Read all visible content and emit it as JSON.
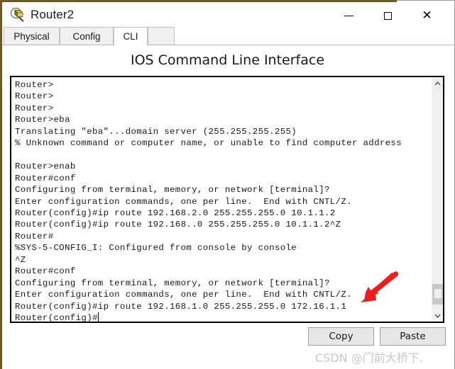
{
  "window": {
    "title": "Router2",
    "icon": "router-magnifier-icon",
    "frame_accent_color": "#6b5c23",
    "controls": [
      {
        "name": "minimize-button",
        "glyph": "minimize-icon",
        "label": "—"
      },
      {
        "name": "maximize-button",
        "glyph": "maximize-icon",
        "label": "☐"
      },
      {
        "name": "close-button",
        "glyph": "close-icon",
        "label": "✕"
      }
    ]
  },
  "tabs": {
    "items": [
      {
        "label": "Physical",
        "active": false
      },
      {
        "label": "Config",
        "active": false
      },
      {
        "label": "CLI",
        "active": true
      }
    ],
    "selected": "CLI"
  },
  "main": {
    "heading": "IOS Command Line Interface",
    "terminal": {
      "text": "Router>\nRouter>\nRouter>\nRouter>eba\nTranslating \"eba\"...domain server (255.255.255.255)\n% Unknown command or computer name, or unable to find computer address\n\nRouter>enab\nRouter#conf\nConfiguring from terminal, memory, or network [terminal]?\nEnter configuration commands, one per line.  End with CNTL/Z.\nRouter(config)#ip route 192.168.2.0 255.255.255.0 10.1.1.2\nRouter(config)#ip route 192.168..0 255.255.255.0 10.1.1.2^Z\nRouter#\n%SYS-5-CONFIG_I: Configured from console by console\n^Z\nRouter#conf\nConfiguring from terminal, memory, or network [terminal]?\nEnter configuration commands, one per line.  End with CNTL/Z.\nRouter(config)#ip route 192.168.1.0 255.255.255.0 172.16.1.1\nRouter(config)#",
      "lines": [
        "Router>",
        "Router>",
        "Router>",
        "Router>eba",
        "Translating \"eba\"...domain server (255.255.255.255)",
        "% Unknown command or computer name, or unable to find computer address",
        "",
        "Router>enab",
        "Router#conf",
        "Configuring from terminal, memory, or network [terminal]?",
        "Enter configuration commands, one per line.  End with CNTL/Z.",
        "Router(config)#ip route 192.168.2.0 255.255.255.0 10.1.1.2",
        "Router(config)#ip route 192.168..0 255.255.255.0 10.1.1.2^Z",
        "Router#",
        "%SYS-5-CONFIG_I: Configured from console by console",
        "^Z",
        "Router#conf",
        "Configuring from terminal, memory, or network [terminal]?",
        "Enter configuration commands, one per line.  End with CNTL/Z.",
        "Router(config)#ip route 192.168.1.0 255.255.255.0 172.16.1.1",
        "Router(config)#"
      ],
      "prompt_last": "Router(config)#",
      "cursor_visible": true
    },
    "scrollbar": {
      "up_arrow": "∧",
      "down_arrow": "∨",
      "thumb_position": "near-bottom"
    },
    "annotation": {
      "type": "red-arrow",
      "color": "#ee1d1d",
      "points_to": "Router(config)#ip route 192.168.1.0 255.255.255.0 172.16.1.1"
    }
  },
  "footer": {
    "copy_label": "Copy",
    "paste_label": "Paste",
    "watermark": "CSDN @门前大桥下."
  }
}
